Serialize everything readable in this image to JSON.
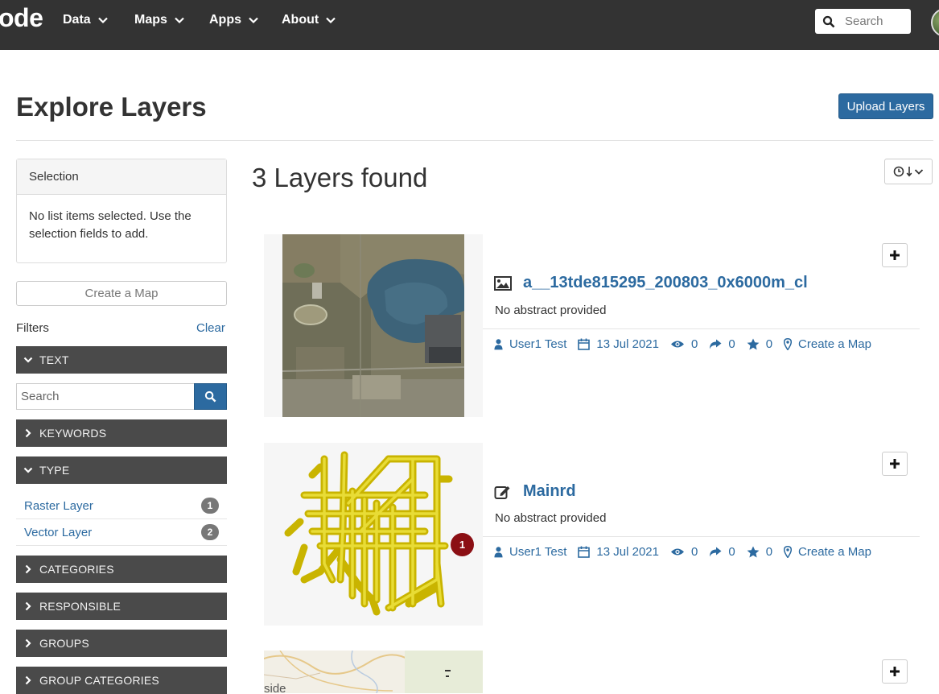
{
  "navbar": {
    "brand": "ode",
    "menu": [
      {
        "label": "Data"
      },
      {
        "label": "Maps"
      },
      {
        "label": "Apps"
      },
      {
        "label": "About"
      }
    ],
    "search_placeholder": "Search"
  },
  "header": {
    "title": "Explore Layers",
    "upload_label": "Upload Layers"
  },
  "sidebar": {
    "selection": {
      "title": "Selection",
      "body": "No list items selected. Use the selection fields to add."
    },
    "create_map_label": "Create a Map",
    "filters_label": "Filters",
    "clear_label": "Clear",
    "facets": {
      "text": "TEXT",
      "keywords": "KEYWORDS",
      "type": "TYPE",
      "categories": "CATEGORIES",
      "responsible": "RESPONSIBLE",
      "groups": "GROUPS",
      "group_categories": "GROUP CATEGORIES"
    },
    "text_search_placeholder": "Search",
    "type_items": [
      {
        "label": "Raster Layer",
        "count": "1"
      },
      {
        "label": "Vector Layer",
        "count": "2"
      }
    ]
  },
  "results": {
    "title": "3 Layers found",
    "items": [
      {
        "title": "a__13tde815295_200803_0x6000m_cl",
        "icon": "image-icon",
        "abstract": "No abstract provided",
        "owner": "User1 Test",
        "date": "13 Jul 2021",
        "views": "0",
        "shares": "0",
        "rating": "0",
        "create_map": "Create a Map"
      },
      {
        "title": "Mainrd",
        "icon": "edit-icon",
        "abstract": "No abstract provided",
        "owner": "User1 Test",
        "date": "13 Jul 2021",
        "views": "0",
        "shares": "0",
        "rating": "0",
        "create_map": "Create a Map",
        "badge": "1"
      },
      {
        "thumb_text": "side"
      }
    ]
  },
  "colors": {
    "navbar": "#333333",
    "link": "#2c6aa0",
    "facet_bg": "#4a4a4a",
    "badge_red": "#8b0f14"
  }
}
